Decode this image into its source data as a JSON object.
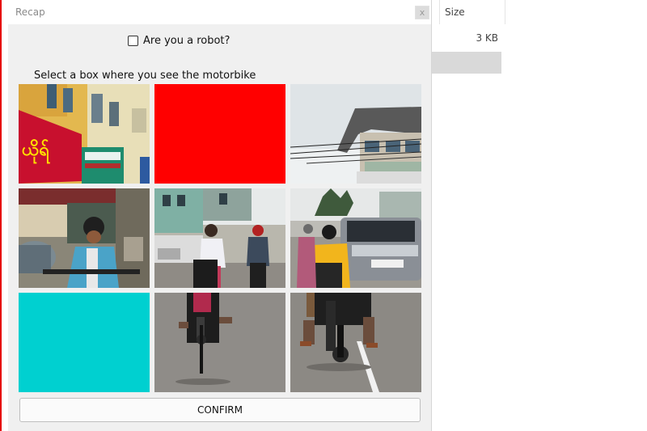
{
  "background_window": {
    "column_header": "Size",
    "file_size": "3 KB"
  },
  "dialog": {
    "title": "Recap",
    "close_label": "x",
    "robot_label": "Are you a robot?",
    "instruction": "Select a box where you see the motorbike",
    "confirm_label": "CONFIRM"
  },
  "tiles": [
    {
      "index": 0,
      "content": "street-buildings-signs"
    },
    {
      "index": 1,
      "content": "solid-red",
      "color": "#ff0000"
    },
    {
      "index": 2,
      "content": "sky-roof-wires"
    },
    {
      "index": 3,
      "content": "rider-street-left"
    },
    {
      "index": 4,
      "content": "riders-center"
    },
    {
      "index": 5,
      "content": "suv-traffic"
    },
    {
      "index": 6,
      "content": "solid-cyan",
      "color": "#00d0d0"
    },
    {
      "index": 7,
      "content": "motorbike-road"
    },
    {
      "index": 8,
      "content": "motorbike-rider-right"
    }
  ]
}
